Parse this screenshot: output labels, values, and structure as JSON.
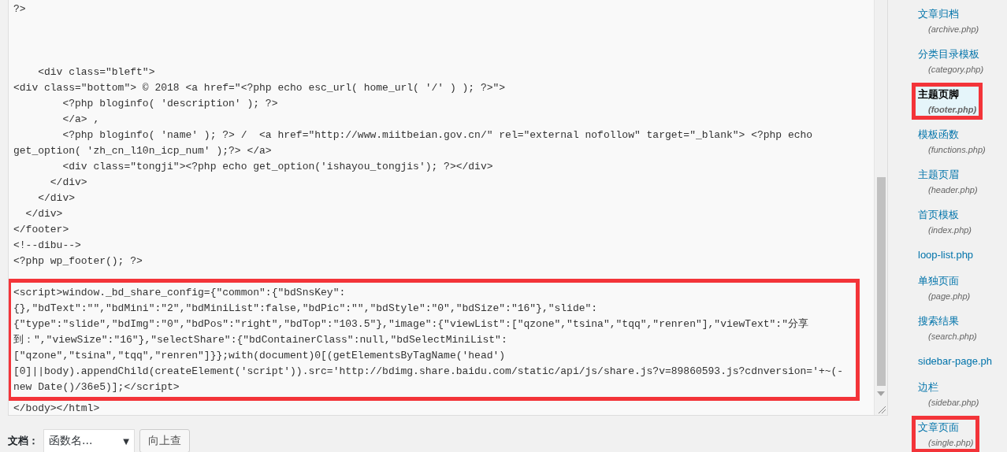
{
  "editor": {
    "blocks": [
      {
        "highlighted": false,
        "lines": [
          {
            "kind": "code",
            "text": "?>"
          },
          {
            "kind": "blank"
          },
          {
            "kind": "blank"
          },
          {
            "kind": "blank"
          }
        ]
      },
      {
        "highlighted": false,
        "lines": [
          {
            "text": "    <div class=\"bleft\">"
          },
          {
            "text": "<div class=\"bottom\"> © 2018 <a href=\"<?php echo esc_url( home_url( '/' ) ); ?>\">"
          },
          {
            "text": "        <?php bloginfo( 'description' ); ?>"
          },
          {
            "text": "        </a> ,"
          },
          {
            "text": "        <?php bloginfo( 'name' ); ?> /  <a href=\"http://www.miitbeian.gov.cn/\" rel=\"external nofollow\" target=\"_blank\"> <?php echo"
          },
          {
            "text": "get_option( 'zh_cn_l10n_icp_num' );?> </a>"
          },
          {
            "text": "        <div class=\"tongji\"><?php echo get_option('ishayou_tongjis'); ?></div>"
          },
          {
            "text": "      </div>"
          },
          {
            "text": "    </div>"
          },
          {
            "text": "  </div>"
          },
          {
            "text": "</footer>"
          },
          {
            "text": "<!--dibu-->"
          },
          {
            "text": "<?php wp_footer(); ?>"
          },
          {
            "kind": "blank"
          }
        ]
      },
      {
        "highlighted": true,
        "lines": [
          {
            "text": "<script>window._bd_share_config={\"common\":{\"bdSnsKey\":"
          },
          {
            "text": "{},\"bdText\":\"\",\"bdMini\":\"2\",\"bdMiniList\":false,\"bdPic\":\"\",\"bdStyle\":\"0\",\"bdSize\":\"16\"},\"slide\":"
          },
          {
            "text": "{\"type\":\"slide\",\"bdImg\":\"0\",\"bdPos\":\"right\",\"bdTop\":\"103.5\"},\"image\":{\"viewList\":[\"qzone\",\"tsina\",\"tqq\",\"renren\"],\"viewText\":\"分享"
          },
          {
            "text": "到：\",\"viewSize\":\"16\"},\"selectShare\":{\"bdContainerClass\":null,\"bdSelectMiniList\":"
          },
          {
            "text": "[\"qzone\",\"tsina\",\"tqq\",\"renren\"]}};with(document)0[(getElementsByTagName('head')"
          },
          {
            "text": "[0]||body).appendChild(createElement('script')).src='http://bdimg.share.baidu.com/static/api/js/share.js?v=89860593.js?cdnversion='+~(-"
          },
          {
            "text": "new Date()/36e5)];</script>"
          }
        ]
      },
      {
        "highlighted": false,
        "lines": [
          {
            "text": "</body></html>"
          }
        ]
      }
    ]
  },
  "doc_lookup": {
    "label": "文档：",
    "select": {
      "value": "函数名...",
      "arrow": "▼"
    },
    "button": "向上查"
  },
  "sidebar": {
    "items": [
      {
        "name": "文章归档",
        "file": "(archive.php)",
        "selected": false,
        "highlighted": false
      },
      {
        "name": "分类目录模板",
        "file": "(category.php)",
        "selected": false,
        "highlighted": false
      },
      {
        "name": "主题页脚",
        "file": "(footer.php)",
        "selected": true,
        "highlighted": true
      },
      {
        "name": "模板函数",
        "file": "(functions.php)",
        "selected": false,
        "highlighted": false
      },
      {
        "name": "主题页眉",
        "file": "(header.php)",
        "selected": false,
        "highlighted": false
      },
      {
        "name": "首页模板",
        "file": "(index.php)",
        "selected": false,
        "highlighted": false
      },
      {
        "name": "loop-list.php",
        "selected": false,
        "highlighted": false
      },
      {
        "name": "单独页面",
        "file": "(page.php)",
        "selected": false,
        "highlighted": false
      },
      {
        "name": "搜索结果",
        "file": "(search.php)",
        "selected": false,
        "highlighted": false
      },
      {
        "name": "sidebar-page.ph",
        "selected": false,
        "highlighted": false
      },
      {
        "name": "边栏",
        "file": "(sidebar.php)",
        "selected": false,
        "highlighted": false
      },
      {
        "name": "文章页面",
        "file": "(single.php)",
        "selected": false,
        "highlighted": true
      }
    ]
  }
}
